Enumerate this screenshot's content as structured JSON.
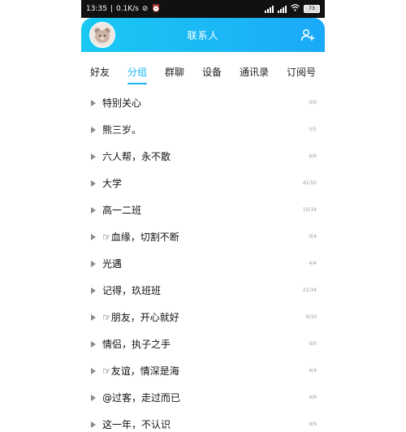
{
  "status_bar": {
    "time": "13:35",
    "speed": "0.1K/s",
    "battery": "73"
  },
  "header": {
    "title": "联系人"
  },
  "tabs": [
    "好友",
    "分组",
    "群聊",
    "设备",
    "通讯录",
    "订阅号"
  ],
  "active_tab": 1,
  "groups": [
    {
      "name": "特别关心",
      "count": "0/0"
    },
    {
      "name": "熊三岁。",
      "count": "5/5"
    },
    {
      "name": "六人帮，永不散",
      "count": "6/6"
    },
    {
      "name": "大学",
      "count": "41/50"
    },
    {
      "name": "高一二班",
      "count": "10/34"
    },
    {
      "name": "☞血缘，切割不断",
      "count": "0/4"
    },
    {
      "name": "光遇",
      "count": "4/4"
    },
    {
      "name": "记得，玖班班",
      "count": "21/34"
    },
    {
      "name": "☞朋友，开心就好",
      "count": "9/10"
    },
    {
      "name": "情侣，执子之手",
      "count": "0/0"
    },
    {
      "name": "☞友谊，情深是海",
      "count": "4/4"
    },
    {
      "name": "@过客，走过而已",
      "count": "4/9"
    },
    {
      "name": "这一年，不认识",
      "count": "9/9"
    }
  ],
  "colors": {
    "accent": "#19b6f5",
    "header_gradient_start": "#19c8f3",
    "header_gradient_end": "#1ba9f7"
  },
  "icons": {
    "avatar": "avatar-bear",
    "add_friend": "add-friend-icon",
    "group_caret": "caret-right-icon"
  }
}
